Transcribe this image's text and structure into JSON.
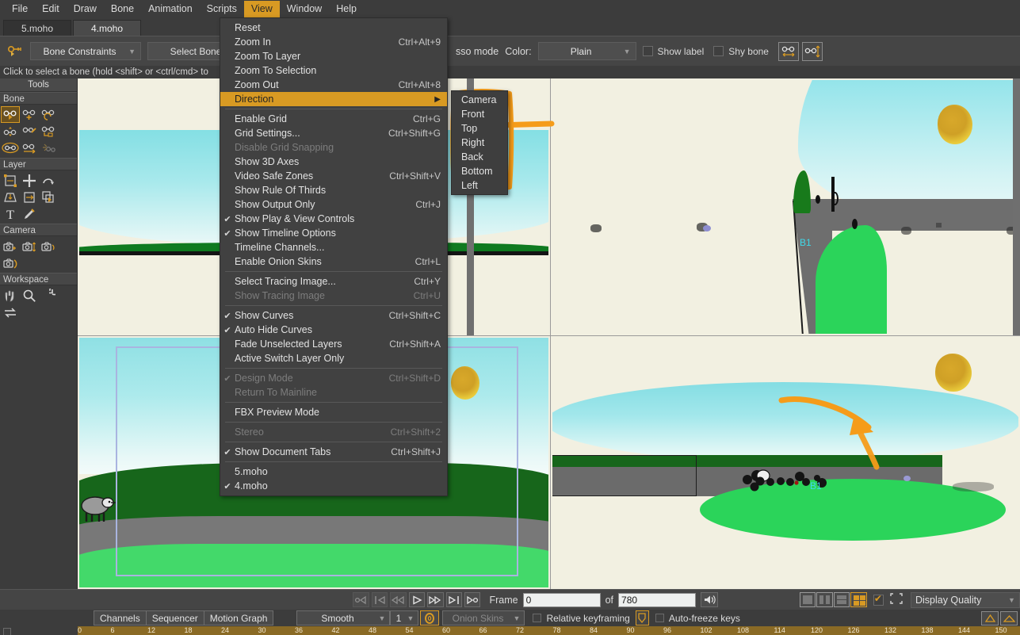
{
  "app": {
    "name": "Moho"
  },
  "menubar": {
    "items": [
      {
        "label": "File",
        "active": false
      },
      {
        "label": "Edit",
        "active": false
      },
      {
        "label": "Draw",
        "active": false
      },
      {
        "label": "Bone",
        "active": false
      },
      {
        "label": "Animation",
        "active": false
      },
      {
        "label": "Scripts",
        "active": false
      },
      {
        "label": "View",
        "active": true
      },
      {
        "label": "Window",
        "active": false
      },
      {
        "label": "Help",
        "active": false
      }
    ]
  },
  "tabs": [
    {
      "label": "5.moho",
      "active": false
    },
    {
      "label": "4.moho",
      "active": true
    }
  ],
  "toolbar": {
    "tool_icon": "bone-key-icon",
    "constraints_dropdown": "Bone Constraints",
    "select_bone_button": "Select Bone",
    "lasso_mode_label": "sso mode",
    "color_label": "Color:",
    "color_value": "Plain",
    "show_label_checkbox": "Show label",
    "shy_bone_checkbox": "Shy bone",
    "extra_icon_1": "bone-width-icon",
    "extra_icon_2": "bone-height-icon"
  },
  "hint": "Click to select a bone (hold <shift> or <ctrl/cmd> to",
  "tools_panel": {
    "title": "Tools",
    "sections": [
      {
        "name": "Bone",
        "tools": [
          {
            "icon": "bone-select-icon",
            "selected": true
          },
          {
            "icon": "bone-add-icon",
            "selected": false
          },
          {
            "icon": "bone-rotate-icon",
            "selected": false
          },
          {
            "icon": "bone-scale-icon",
            "selected": false
          },
          {
            "icon": "bone-strength-icon",
            "selected": false
          },
          {
            "icon": "bone-bind-layer-icon",
            "selected": false
          },
          {
            "icon": "bone-flexi-icon",
            "selected": false
          },
          {
            "icon": "bone-offset-icon",
            "selected": false
          },
          {
            "icon": "bone-dynamics-icon",
            "selected": false
          }
        ]
      },
      {
        "name": "Layer",
        "tools": [
          {
            "icon": "layer-transform-icon",
            "selected": false
          },
          {
            "icon": "layer-translate-icon",
            "selected": false
          },
          {
            "icon": "layer-rotate-icon",
            "selected": false
          },
          {
            "icon": "layer-shear-icon",
            "selected": false
          },
          {
            "icon": "layer-flip-icon",
            "selected": false
          },
          {
            "icon": "layer-set-origin-icon",
            "selected": false
          },
          {
            "icon": "text-tool-icon",
            "selected": false
          },
          {
            "icon": "eyedropper-icon",
            "selected": false
          }
        ]
      },
      {
        "name": "Camera",
        "tools": [
          {
            "icon": "camera-track-icon",
            "selected": false
          },
          {
            "icon": "camera-zoom-icon",
            "selected": false
          },
          {
            "icon": "camera-roll-icon",
            "selected": false
          },
          {
            "icon": "camera-pan-tilt-icon",
            "selected": false
          }
        ]
      },
      {
        "name": "Workspace",
        "tools": [
          {
            "icon": "pan-hand-icon",
            "selected": false
          },
          {
            "icon": "magnifier-icon",
            "selected": false
          },
          {
            "icon": "rotate-workspace-icon",
            "selected": false
          },
          {
            "icon": "reset-workspace-icon",
            "selected": false
          }
        ]
      }
    ]
  },
  "view_menu": {
    "rows": [
      {
        "label": "Reset",
        "accel": "",
        "checked": false,
        "disabled": false,
        "highlight": false,
        "submenu": false
      },
      {
        "label": "Zoom In",
        "accel": "Ctrl+Alt+9",
        "checked": false,
        "disabled": false,
        "highlight": false,
        "submenu": false
      },
      {
        "label": "Zoom To Layer",
        "accel": "",
        "checked": false,
        "disabled": false,
        "highlight": false,
        "submenu": false
      },
      {
        "label": "Zoom To Selection",
        "accel": "",
        "checked": false,
        "disabled": false,
        "highlight": false,
        "submenu": false
      },
      {
        "label": "Zoom Out",
        "accel": "Ctrl+Alt+8",
        "checked": false,
        "disabled": false,
        "highlight": false,
        "submenu": false
      },
      {
        "label": "Direction",
        "accel": "",
        "checked": false,
        "disabled": false,
        "highlight": true,
        "submenu": true
      },
      {
        "separator": true
      },
      {
        "label": "Enable Grid",
        "accel": "Ctrl+G",
        "checked": false,
        "disabled": false,
        "highlight": false,
        "submenu": false
      },
      {
        "label": "Grid Settings...",
        "accel": "Ctrl+Shift+G",
        "checked": false,
        "disabled": false,
        "highlight": false,
        "submenu": false
      },
      {
        "label": "Disable Grid Snapping",
        "accel": "",
        "checked": false,
        "disabled": true,
        "highlight": false,
        "submenu": false
      },
      {
        "label": "Show 3D Axes",
        "accel": "",
        "checked": false,
        "disabled": false,
        "highlight": false,
        "submenu": false
      },
      {
        "label": "Video Safe Zones",
        "accel": "Ctrl+Shift+V",
        "checked": false,
        "disabled": false,
        "highlight": false,
        "submenu": false
      },
      {
        "label": "Show Rule Of Thirds",
        "accel": "",
        "checked": false,
        "disabled": false,
        "highlight": false,
        "submenu": false
      },
      {
        "label": "Show Output Only",
        "accel": "Ctrl+J",
        "checked": false,
        "disabled": false,
        "highlight": false,
        "submenu": false
      },
      {
        "label": "Show Play & View Controls",
        "accel": "",
        "checked": true,
        "disabled": false,
        "highlight": false,
        "submenu": false
      },
      {
        "label": "Show Timeline Options",
        "accel": "",
        "checked": true,
        "disabled": false,
        "highlight": false,
        "submenu": false
      },
      {
        "label": "Timeline Channels...",
        "accel": "",
        "checked": false,
        "disabled": false,
        "highlight": false,
        "submenu": false
      },
      {
        "label": "Enable Onion Skins",
        "accel": "Ctrl+L",
        "checked": false,
        "disabled": false,
        "highlight": false,
        "submenu": false
      },
      {
        "separator": true
      },
      {
        "label": "Select Tracing Image...",
        "accel": "Ctrl+Y",
        "checked": false,
        "disabled": false,
        "highlight": false,
        "submenu": false
      },
      {
        "label": "Show Tracing Image",
        "accel": "Ctrl+U",
        "checked": false,
        "disabled": true,
        "highlight": false,
        "submenu": false
      },
      {
        "separator": true
      },
      {
        "label": "Show Curves",
        "accel": "Ctrl+Shift+C",
        "checked": true,
        "disabled": false,
        "highlight": false,
        "submenu": false
      },
      {
        "label": "Auto Hide Curves",
        "accel": "",
        "checked": true,
        "disabled": false,
        "highlight": false,
        "submenu": false
      },
      {
        "label": "Fade Unselected Layers",
        "accel": "Ctrl+Shift+A",
        "checked": false,
        "disabled": false,
        "highlight": false,
        "submenu": false
      },
      {
        "label": "Active Switch Layer Only",
        "accel": "",
        "checked": false,
        "disabled": false,
        "highlight": false,
        "submenu": false
      },
      {
        "separator": true
      },
      {
        "label": "Design Mode",
        "accel": "Ctrl+Shift+D",
        "checked": true,
        "disabled": true,
        "highlight": false,
        "submenu": false
      },
      {
        "label": "Return To Mainline",
        "accel": "",
        "checked": false,
        "disabled": true,
        "highlight": false,
        "submenu": false
      },
      {
        "separator": true
      },
      {
        "label": "FBX Preview Mode",
        "accel": "",
        "checked": false,
        "disabled": false,
        "highlight": false,
        "submenu": false
      },
      {
        "separator": true
      },
      {
        "label": "Stereo",
        "accel": "Ctrl+Shift+2",
        "checked": false,
        "disabled": true,
        "highlight": false,
        "submenu": false
      },
      {
        "separator": true
      },
      {
        "label": "Show Document Tabs",
        "accel": "Ctrl+Shift+J",
        "checked": true,
        "disabled": false,
        "highlight": false,
        "submenu": false
      },
      {
        "separator": true
      },
      {
        "label": "5.moho",
        "accel": "",
        "checked": false,
        "disabled": false,
        "highlight": false,
        "submenu": false
      },
      {
        "label": "4.moho",
        "accel": "",
        "checked": true,
        "disabled": false,
        "highlight": false,
        "submenu": false
      }
    ]
  },
  "direction_submenu": {
    "items": [
      "Camera",
      "Front",
      "Top",
      "Right",
      "Back",
      "Bottom",
      "Left"
    ],
    "annotated_item": "Top"
  },
  "viewports": {
    "top_left": {
      "name": "front-view",
      "bone_label": ""
    },
    "top_right": {
      "name": "perspective-view",
      "bone_label": "B1"
    },
    "bottom_left": {
      "name": "camera-view",
      "bone_label": ""
    },
    "bottom_right": {
      "name": "top-view",
      "bone_label": "B1"
    }
  },
  "playback": {
    "buttons": [
      {
        "icon": "rewind-to-start-icon",
        "disabled": true
      },
      {
        "icon": "step-back-keyframe-icon",
        "disabled": true
      },
      {
        "icon": "step-back-frame-icon",
        "disabled": true
      },
      {
        "icon": "play-icon",
        "disabled": false
      },
      {
        "icon": "fast-forward-icon",
        "disabled": false
      },
      {
        "icon": "step-forward-frame-icon",
        "disabled": false
      },
      {
        "icon": "play-to-end-icon",
        "disabled": false
      }
    ],
    "frame_label": "Frame",
    "frame_value": "0",
    "of_label": "of",
    "total_frames": "780",
    "sound_icon": "speaker-icon",
    "layout_buttons": [
      {
        "icon": "single-view-icon",
        "selected": false
      },
      {
        "icon": "two-column-view-icon",
        "selected": false
      },
      {
        "icon": "two-row-view-icon",
        "selected": false
      },
      {
        "icon": "quad-view-icon",
        "selected": true
      }
    ],
    "layout_checkbox_checked": true,
    "crop_icon": "selection-bounds-icon",
    "display_quality_label": "Display Quality"
  },
  "timeline": {
    "tabs": [
      "Channels",
      "Sequencer",
      "Motion Graph"
    ],
    "interpolation": "Smooth",
    "frame_step": "1",
    "onion_icon": "onion-skin-icon",
    "onion_skins_label": "Onion Skins",
    "relative_keyframing_label": "Relative keyframing",
    "relative_keyframing_checked": false,
    "shield_icon": "keyframe-shield-icon",
    "auto_freeze_label": "Auto-freeze keys",
    "auto_freeze_checked": false,
    "right_buttons": [
      "expand-up-icon",
      "collapse-icon"
    ],
    "ruler_ticks": [
      "6",
      "12",
      "18",
      "24",
      "30",
      "36",
      "42",
      "48",
      "54",
      "60",
      "66",
      "72",
      "78",
      "84",
      "90",
      "96",
      "102",
      "108",
      "114",
      "120",
      "126",
      "132",
      "138",
      "144",
      "150"
    ]
  },
  "colors": {
    "accent": "#d89a23",
    "panel_bg": "#3c3c3c",
    "toolbar_bg": "#454545",
    "menu_bg": "#414141",
    "annotation": "#f59c1a",
    "viewport_bg": "#f2f0e1",
    "sky": "#8ce0e6",
    "grass_dark": "#1f7a1f",
    "grass_light": "#3fd45f",
    "road": "#707070",
    "sun": "#d8a82a",
    "bone_label": "#3fd8e8"
  }
}
